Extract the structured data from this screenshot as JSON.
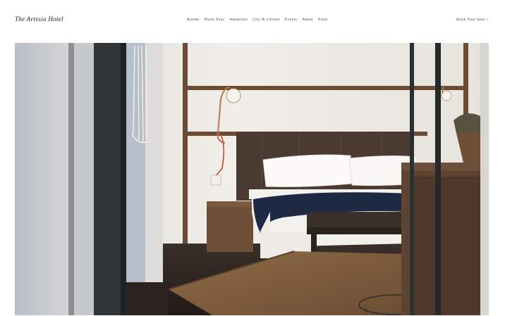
{
  "header": {
    "logo": "The Artesia Hotel",
    "nav": [
      "Rooms",
      "Photo Tour",
      "Amenities",
      "City & Culture",
      "Events",
      "About",
      "Press"
    ],
    "book_label": "Book Your Stay +"
  },
  "colors": {
    "background": "#ffffff",
    "text": "#222222",
    "wall": "#ece8e2",
    "blanket": "#1e2a44",
    "headboard": "#4a3a31"
  }
}
